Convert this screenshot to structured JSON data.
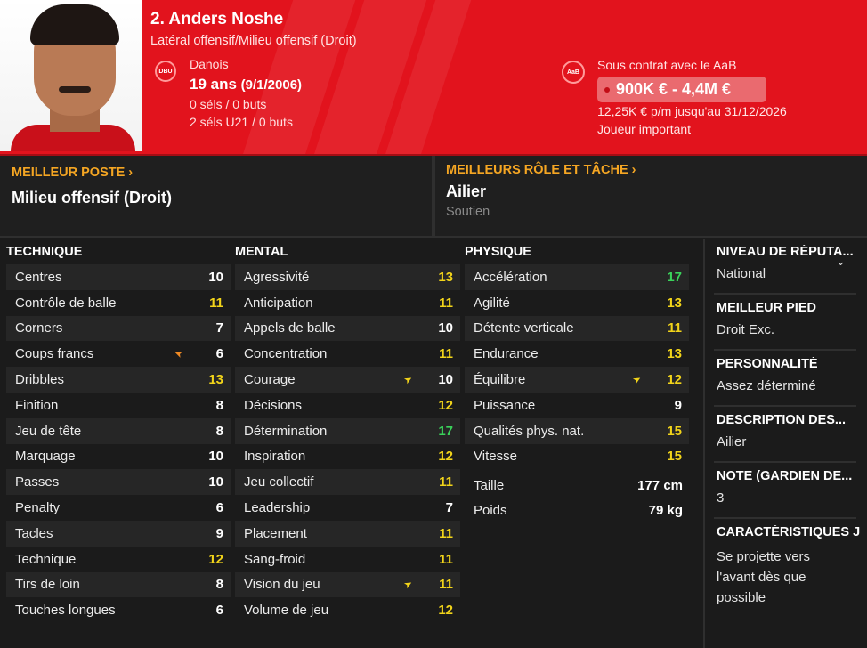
{
  "header": {
    "name": "2. Anders Noshe",
    "positions": "Latéral offensif/Milieu offensif (Droit)",
    "nationality": "Danois",
    "age": "19 ans",
    "birthdate": "(9/1/2006)",
    "caps_senior": "0 séls / 0 buts",
    "caps_u21": "2 séls U21 / 0 buts",
    "contract_with": "Sous contrat avec le AaB",
    "value_range": "900K € - 4,4M €",
    "wage": "12,25K € p/m jusqu'au 31/12/2026",
    "status": "Joueur important",
    "accent_color": "#e2131d"
  },
  "best_position": {
    "heading": "MEILLEUR POSTE",
    "value": "Milieu offensif (Droit)"
  },
  "best_role": {
    "heading": "MEILLEURS RÔLE ET TÂCHE",
    "value": "Ailier",
    "duty": "Soutien"
  },
  "technique": {
    "title": "TECHNIQUE",
    "rows": [
      {
        "label": "Centres",
        "value": "10",
        "color": "white"
      },
      {
        "label": "Contrôle de balle",
        "value": "11",
        "color": "yellow"
      },
      {
        "label": "Corners",
        "value": "7",
        "color": "white"
      },
      {
        "label": "Coups francs",
        "value": "6",
        "color": "white",
        "arrow": "orange"
      },
      {
        "label": "Dribbles",
        "value": "13",
        "color": "yellow"
      },
      {
        "label": "Finition",
        "value": "8",
        "color": "white"
      },
      {
        "label": "Jeu de tête",
        "value": "8",
        "color": "white"
      },
      {
        "label": "Marquage",
        "value": "10",
        "color": "white"
      },
      {
        "label": "Passes",
        "value": "10",
        "color": "white"
      },
      {
        "label": "Penalty",
        "value": "6",
        "color": "white"
      },
      {
        "label": "Tacles",
        "value": "9",
        "color": "white"
      },
      {
        "label": "Technique",
        "value": "12",
        "color": "yellow"
      },
      {
        "label": "Tirs de loin",
        "value": "8",
        "color": "white"
      },
      {
        "label": "Touches longues",
        "value": "6",
        "color": "white"
      }
    ]
  },
  "mental": {
    "title": "MENTAL",
    "rows": [
      {
        "label": "Agressivité",
        "value": "13",
        "color": "yellow"
      },
      {
        "label": "Anticipation",
        "value": "11",
        "color": "yellow"
      },
      {
        "label": "Appels de balle",
        "value": "10",
        "color": "white"
      },
      {
        "label": "Concentration",
        "value": "11",
        "color": "yellow"
      },
      {
        "label": "Courage",
        "value": "10",
        "color": "white",
        "arrow": "yellow"
      },
      {
        "label": "Décisions",
        "value": "12",
        "color": "yellow"
      },
      {
        "label": "Détermination",
        "value": "17",
        "color": "green"
      },
      {
        "label": "Inspiration",
        "value": "12",
        "color": "yellow"
      },
      {
        "label": "Jeu collectif",
        "value": "11",
        "color": "yellow"
      },
      {
        "label": "Leadership",
        "value": "7",
        "color": "white"
      },
      {
        "label": "Placement",
        "value": "11",
        "color": "yellow"
      },
      {
        "label": "Sang-froid",
        "value": "11",
        "color": "yellow"
      },
      {
        "label": "Vision du jeu",
        "value": "11",
        "color": "yellow",
        "arrow": "yellow"
      },
      {
        "label": "Volume de jeu",
        "value": "12",
        "color": "yellow"
      }
    ]
  },
  "physique": {
    "title": "PHYSIQUE",
    "rows": [
      {
        "label": "Accélération",
        "value": "17",
        "color": "green"
      },
      {
        "label": "Agilité",
        "value": "13",
        "color": "yellow"
      },
      {
        "label": "Détente verticale",
        "value": "11",
        "color": "yellow"
      },
      {
        "label": "Endurance",
        "value": "13",
        "color": "yellow"
      },
      {
        "label": "Équilibre",
        "value": "12",
        "color": "yellow",
        "arrow": "yellow"
      },
      {
        "label": "Puissance",
        "value": "9",
        "color": "white"
      },
      {
        "label": "Qualités phys. nat.",
        "value": "15",
        "color": "yellow"
      },
      {
        "label": "Vitesse",
        "value": "15",
        "color": "yellow"
      }
    ],
    "height_label": "Taille",
    "height": "177 cm",
    "weight_label": "Poids",
    "weight": "79 kg"
  },
  "side": {
    "reputation_heading": "NIVEAU DE RÉPUTA...",
    "reputation": "National",
    "foot_heading": "MEILLEUR PIED",
    "foot": "Droit Exc.",
    "personality_heading": "PERSONNALITÉ",
    "personality": "Assez déterminé",
    "description_heading": "DESCRIPTION DES...",
    "description": "Ailier",
    "gk_rating_heading": "NOTE (GARDIEN DE...",
    "gk_rating": "3",
    "traits_heading": "CARACTÉRISTIQUES J",
    "traits": "Se projette vers l'avant dès que possible"
  }
}
